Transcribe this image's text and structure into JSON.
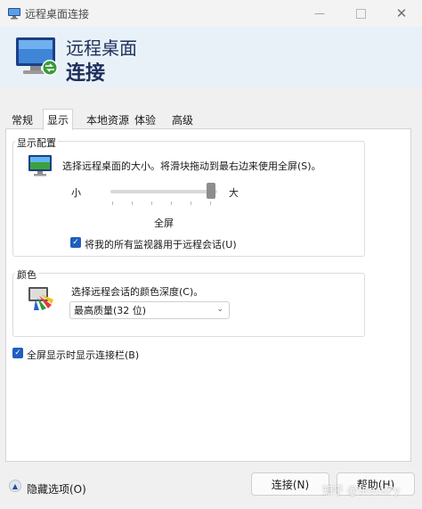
{
  "window": {
    "title": "远程桌面连接",
    "minimize_icon": "minimize-icon",
    "maximize_icon": "maximize-icon",
    "close_icon": "close-icon"
  },
  "header": {
    "line1": "远程桌面",
    "line2": "连接",
    "icon": "remote-desktop-icon"
  },
  "tabs": [
    {
      "label": "常规"
    },
    {
      "label": "显示",
      "active": true
    },
    {
      "label": "本地资源"
    },
    {
      "label": "体验"
    },
    {
      "label": "高级"
    }
  ],
  "display_config": {
    "group_label": "显示配置",
    "description": "选择远程桌面的大小。将滑块拖动到最右边来使用全屏(S)。",
    "small_label": "小",
    "large_label": "大",
    "slider_value": 1.0,
    "current_size": "全屏",
    "all_monitors_label": "将我的所有监视器用于远程会话(U)",
    "all_monitors_checked": true
  },
  "colors": {
    "group_label": "颜色",
    "description": "选择远程会话的颜色深度(C)。",
    "selected": "最高质量(32 位)"
  },
  "show_bar": {
    "label": "全屏显示时显示连接栏(B)",
    "checked": true
  },
  "footer": {
    "hide_options": "隐藏选项(O)",
    "connect": "连接(N)",
    "help": "帮助(H)"
  },
  "watermark": "知乎 @StockPy",
  "theme": {
    "accent": "#1f5fbf",
    "header_bg": "#e9f1f8",
    "header_text": "#1e2f5b"
  }
}
